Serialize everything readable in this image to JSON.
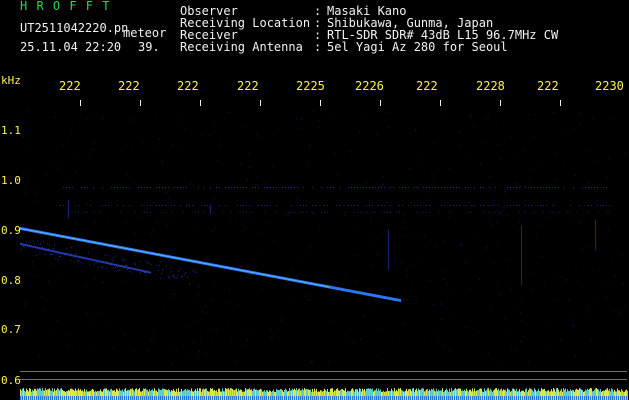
{
  "header": {
    "app_name": "H R O F F T",
    "filename": "UT2511042220.pn",
    "mode": "meteor",
    "date_time": "25.11.04 22:20",
    "count": "39.",
    "info": [
      {
        "label": "Observer",
        "sep": ":",
        "value": "Masaki Kano"
      },
      {
        "label": "Receiving Location",
        "sep": ":",
        "value": "Shibukawa, Gunma, Japan"
      },
      {
        "label": "Receiver",
        "sep": ":",
        "value": "RTL-SDR SDR# 43dB L15 96.7MHz CW"
      },
      {
        "label": "Receiving Antenna",
        "sep": ":",
        "value": "5el Yagi Az 280 for Seoul"
      }
    ]
  },
  "time_axis": {
    "ticks": [
      "222",
      "222",
      "222",
      "222",
      "2225",
      "2226",
      "222",
      "2228",
      "222",
      "2230"
    ]
  },
  "freq_axis": {
    "unit": "kHz",
    "labels": [
      "1.1",
      "1.0",
      "0.9",
      "0.8",
      "0.7",
      "0.6"
    ]
  },
  "colors": {
    "background": "#000000",
    "header_title": "#2bd84a",
    "header_text": "#f2f2f2",
    "axis_text": "#fff34a",
    "signal": "#2f7cff",
    "signal_core": "#69c0ff"
  }
}
